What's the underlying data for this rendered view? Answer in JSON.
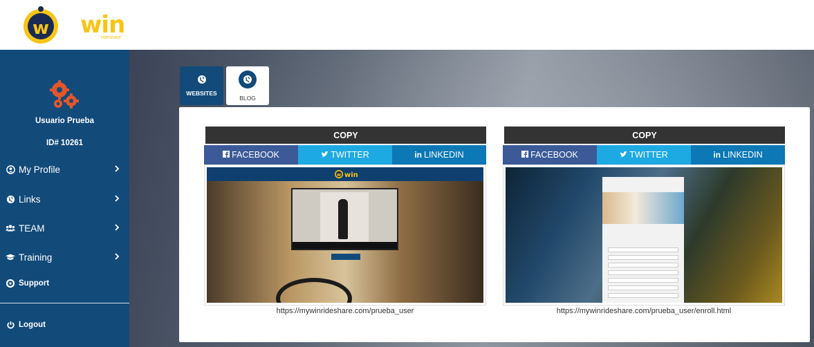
{
  "brand": {
    "name": "win",
    "tagline": "rideshare",
    "color": "#f7c518"
  },
  "sidebar": {
    "username": "Usuario Prueba",
    "user_id": "ID# 10261",
    "items": [
      {
        "label": "My Profile",
        "icon": "user-circle-icon"
      },
      {
        "label": "Links",
        "icon": "globe-icon"
      },
      {
        "label": "TEAM",
        "icon": "users-icon"
      },
      {
        "label": "Training",
        "icon": "graduation-cap-icon"
      },
      {
        "label": "Support",
        "icon": "life-ring-icon"
      }
    ],
    "logout": {
      "label": "Logout",
      "icon": "power-icon"
    }
  },
  "tabs": [
    {
      "label": "WEBSITES",
      "icon": "globe-icon",
      "active": true
    },
    {
      "label": "BLOG",
      "icon": "globe-icon",
      "active": false
    }
  ],
  "cards": [
    {
      "copy_label": "COPY",
      "share": {
        "facebook": "FACEBOOK",
        "twitter": "TWITTER",
        "linkedin": "LINKEDIN"
      },
      "url": "https://mywinrideshare.com/prueba_user"
    },
    {
      "copy_label": "COPY",
      "share": {
        "facebook": "FACEBOOK",
        "twitter": "TWITTER",
        "linkedin": "LINKEDIN"
      },
      "url": "https://mywinrideshare.com/prueba_user/enroll.html"
    }
  ],
  "colors": {
    "sidebar": "#124a7a",
    "facebook": "#3b5a97",
    "twitter": "#1da9e1",
    "linkedin": "#0c78b5",
    "copy": "#333333"
  }
}
